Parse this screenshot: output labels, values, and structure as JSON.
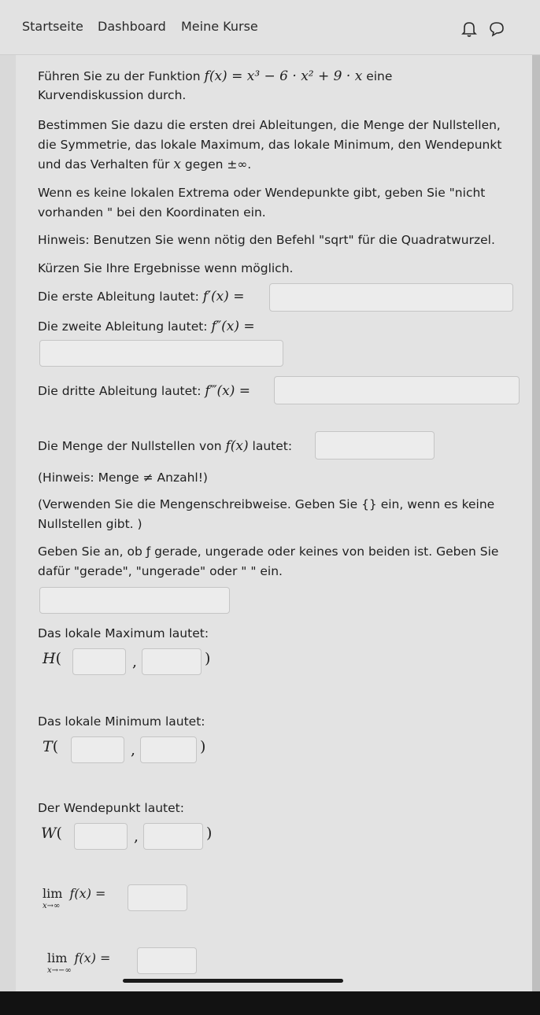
{
  "nav": {
    "items": [
      "Startseite",
      "Dashboard",
      "Meine Kurse"
    ]
  },
  "icons": {
    "notification": "bell-icon",
    "messages": "chat-bubble-icon"
  },
  "task": {
    "intro1": "Führen Sie zu der Funktion",
    "function": "f(x) = x³ − 6 · x² + 9 · x",
    "intro1_end": "eine",
    "intro2": "Kurvendiskussion durch.",
    "p2_l1": "Bestimmen Sie dazu die ersten drei Ableitungen, die Menge der Nullstellen,",
    "p2_l2": "die Symmetrie, das lokale Maximum, das lokale Minimum, den Wendepunkt",
    "p2_l3a": "und das Verhalten für",
    "p2_l3x": "x",
    "p2_l3b": "gegen ±∞.",
    "p3_l1": "Wenn es keine lokalen Extrema oder Wendepunkte gibt, geben Sie \"nicht",
    "p3_l2": "vorhanden \" bei den Koordinaten ein.",
    "hint_sqrt": "Hinweis: Benutzen Sie wenn nötig den Befehl \"sqrt\" für die Quadratwurzel.",
    "hint_simplify": "Kürzen Sie Ihre Ergebnisse wenn möglich."
  },
  "questions": {
    "first_label": "Die erste Ableitung lautet:",
    "first_math": "f′(x) =",
    "second_label": "Die zweite Ableitung lautet:",
    "second_math": "f″(x) =",
    "third_label": "Die dritte Ableitung lautet:",
    "third_math": "f‴(x) =",
    "zeros_label_a": "Die Menge der Nullstellen von",
    "zeros_math": "f(x)",
    "zeros_label_b": "lautet:",
    "zeros_hint1": "(Hinweis: Menge ≠ Anzahl!)",
    "zeros_hint2_l1": "(Verwenden Sie die Mengenschreibweise. Geben Sie {} ein, wenn es keine",
    "zeros_hint2_l2": "Nullstellen gibt. )",
    "sym_l1": "Geben Sie an, ob ƒ gerade, ungerade oder keines von beiden ist. Geben Sie",
    "sym_l2": "dafür \"gerade\", \"ungerade\" oder \" \" ein.",
    "max_label": "Das lokale Maximum lautet:",
    "max_letter": "H",
    "min_label": "Das lokale Minimum lautet:",
    "min_letter": "T",
    "wp_label": "Der Wendepunkt lautet:",
    "wp_letter": "W",
    "open_paren": "(",
    "comma": ",",
    "close_paren": ")",
    "lim_word": "lim",
    "lim_plus_sub": "x→∞",
    "lim_minus_sub": "x→−∞",
    "lim_fx": "f(x) ="
  },
  "inputs": {
    "first_derivative": "",
    "second_derivative": "",
    "third_derivative": "",
    "zeros": "",
    "symmetry": "",
    "max_x": "",
    "max_y": "",
    "min_x": "",
    "min_y": "",
    "wp_x": "",
    "wp_y": "",
    "lim_plus": "",
    "lim_minus": ""
  }
}
